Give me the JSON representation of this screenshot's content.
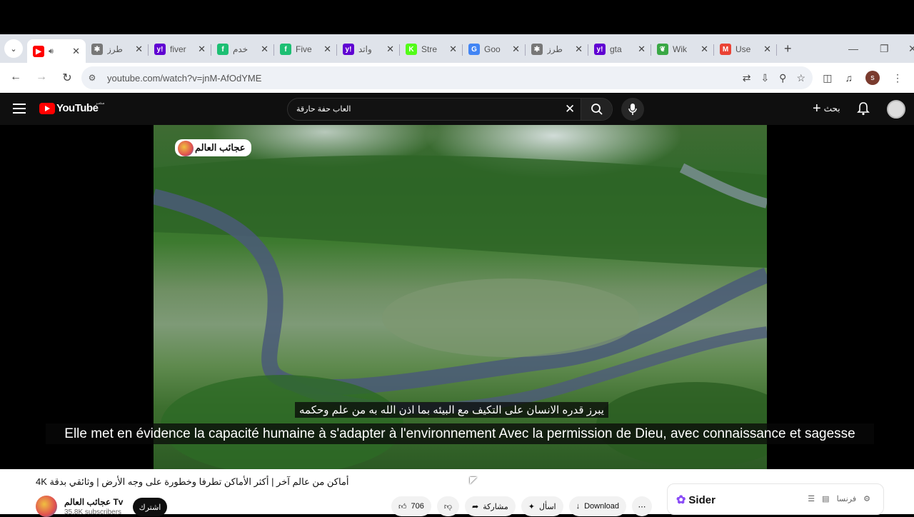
{
  "browser": {
    "tabs": [
      {
        "label": "",
        "favicon": "youtube",
        "color": "#ff0000",
        "active": true,
        "audio": true
      },
      {
        "label": "طرز",
        "favicon": "gear",
        "color": "#777777"
      },
      {
        "label": "fiver",
        "favicon": "yahoo",
        "color": "#6001d2"
      },
      {
        "label": "خدم",
        "favicon": "green-circle",
        "color": "#1dbf73"
      },
      {
        "label": "Five",
        "favicon": "green-circle",
        "color": "#1dbf73"
      },
      {
        "label": "واتد",
        "favicon": "yahoo",
        "color": "#6001d2"
      },
      {
        "label": "Stre",
        "favicon": "k-logo",
        "color": "#53fc18"
      },
      {
        "label": "Goo",
        "favicon": "google",
        "color": "#4285f4"
      },
      {
        "label": "طرز",
        "favicon": "gear",
        "color": "#777777"
      },
      {
        "label": "gta",
        "favicon": "yahoo",
        "color": "#6001d2"
      },
      {
        "label": "Wik",
        "favicon": "leaf",
        "color": "#3aa845"
      },
      {
        "label": "Use",
        "favicon": "gmail",
        "color": "#ea4335"
      }
    ],
    "url": "youtube.com/watch?v=jnM-AfOdYME",
    "profile_initial": "s"
  },
  "youtube": {
    "logo_text": "YouTube",
    "country_code": "مصر",
    "search_query": "العاب حفة حارقة",
    "create_label": "بحث",
    "video": {
      "watermark": "عجائب العالم",
      "subtitle_ar": "يبرز قدره الانسان على التكيف مع البيئه بما اذن الله به من علم وحكمه",
      "subtitle_fr": "Elle met en évidence la capacité humaine à s'adapter à l'environnement Avec la permission de Dieu, avec connaissance et sagesse"
    },
    "title": "أماكن من عالم آخر | أكثر الأماكن تطرفا وخطورة على وجه الأرض | وثائقي بدقة 4K",
    "channel": {
      "name": "عجائب العالم Tv",
      "subscribers": "35.8K subscribers",
      "subscribe_label": "اشترك"
    },
    "actions": {
      "likes": "706",
      "share": "مشاركة",
      "ask": "اسأل",
      "download": "Download"
    }
  },
  "sider": {
    "name": "Sider",
    "lang": "فرنسا"
  }
}
